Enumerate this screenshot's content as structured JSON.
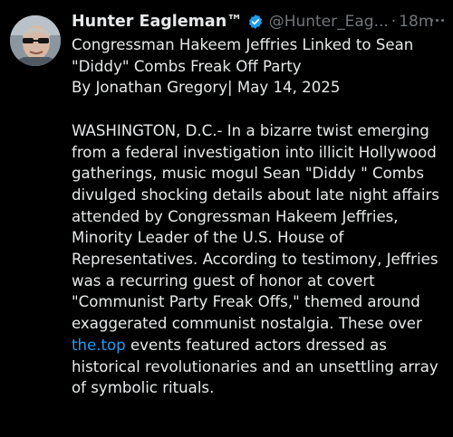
{
  "post": {
    "author": {
      "display_name": "Hunter Eagleman™",
      "handle": "@Hunter_Eag...",
      "verified_icon": "verified-badge-icon"
    },
    "separator": "·",
    "time": "18m",
    "more_icon": "more-horizontal-icon",
    "headline_line1": "Congressman Hakeem Jeffries Linked to Sean",
    "headline_line2": "\"Diddy\" Combs Freak Off Party",
    "byline": "By Jonathan Gregory| May 14, 2025",
    "body_before_link": "WASHINGTON, D.C.- In a bizarre twist emerging from a federal investigation into illicit Hollywood gatherings, music mogul Sean \"Diddy \" Combs divulged shocking details about late night affairs attended by Congressman Hakeem Jeffries, Minority Leader of the U.S. House of Representatives. According to testimony, Jeffries was a recurring guest of honor at covert \"Communist Party Freak Offs,\" themed around exaggerated communist nostalgia. These over ",
    "link_text": "the.top",
    "body_after_link": " events featured actors dressed as historical revolutionaries and an unsettling array of symbolic rituals.",
    "colors": {
      "background": "#000000",
      "text": "#e7e9ea",
      "muted": "#71767b",
      "link": "#1d9bf0",
      "verified": "#1d9bf0"
    }
  }
}
